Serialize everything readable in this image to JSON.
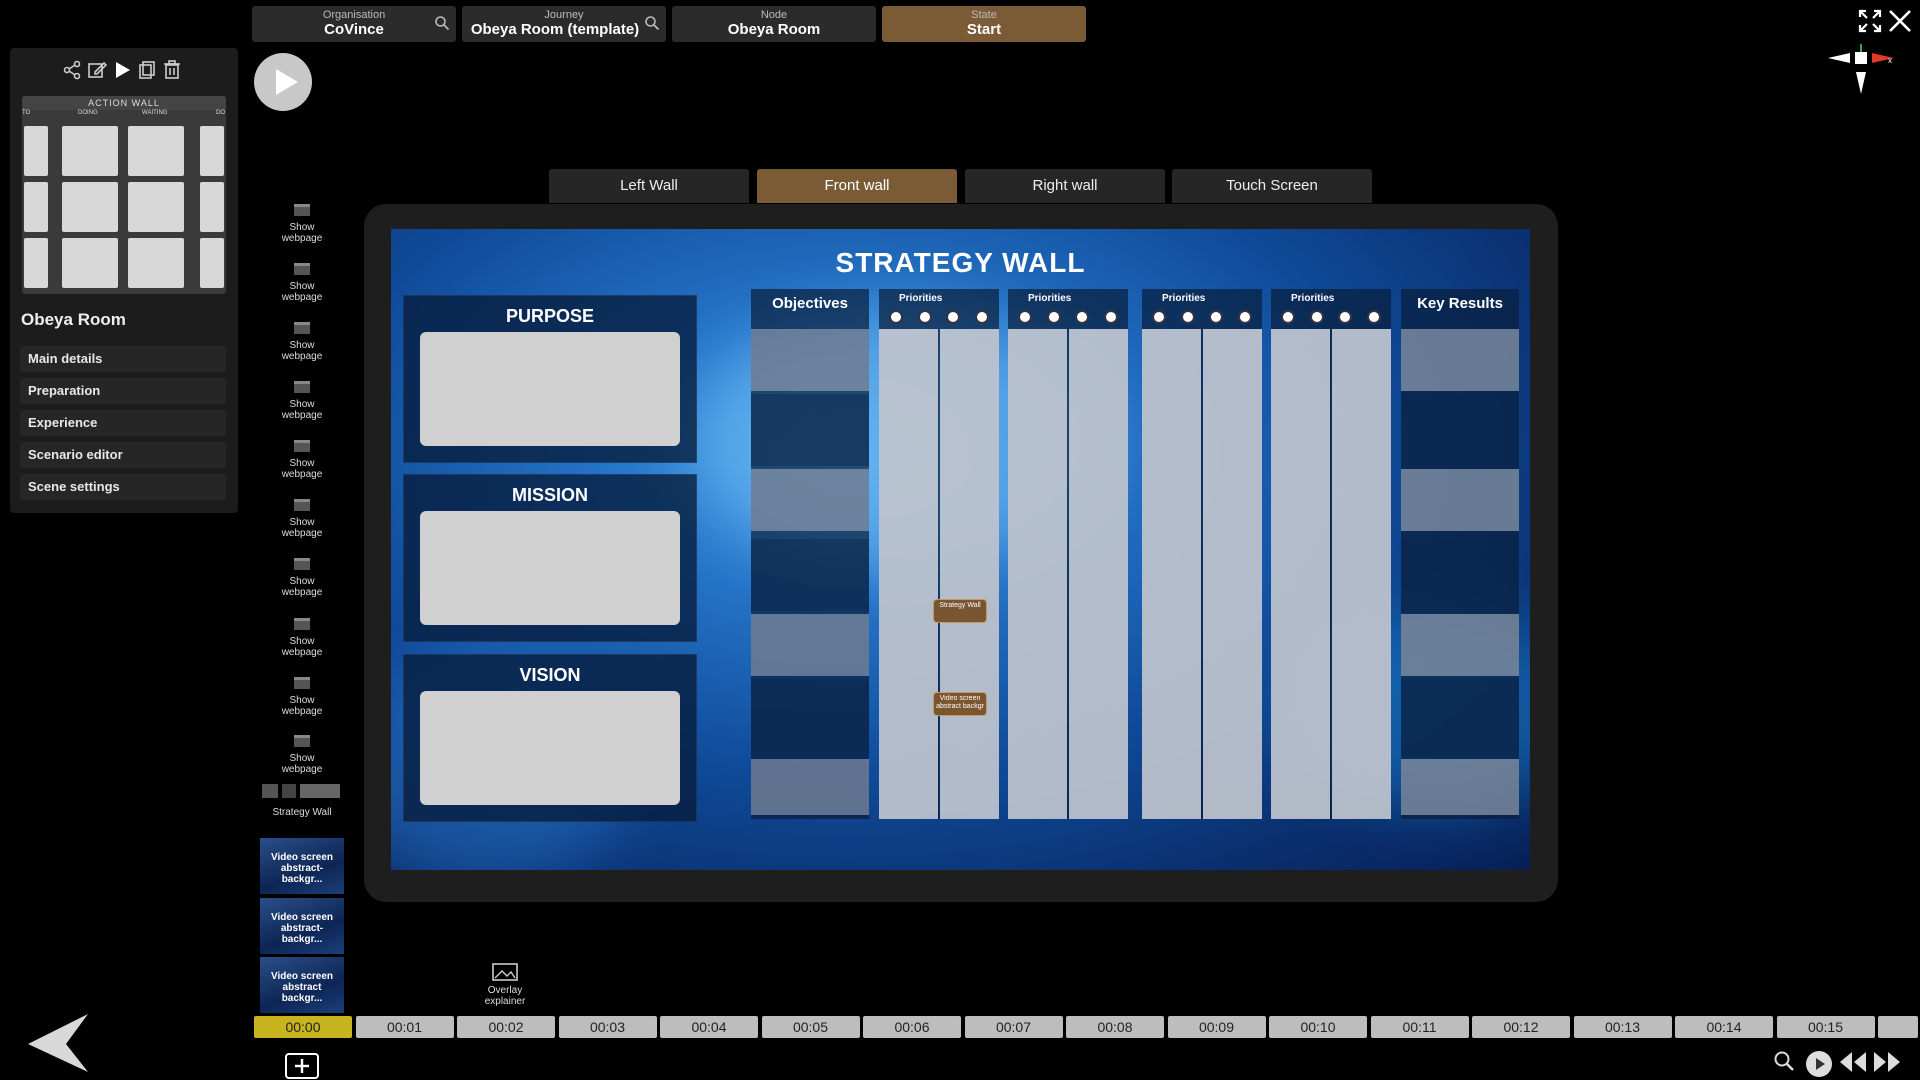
{
  "breadcrumb": [
    {
      "label": "Organisation",
      "value": "CoVince",
      "search": true
    },
    {
      "label": "Journey",
      "value": "Obeya Room (template)",
      "search": true
    },
    {
      "label": "Node",
      "value": "Obeya Room",
      "search": false
    },
    {
      "label": "State",
      "value": "Start",
      "search": false,
      "active": true
    }
  ],
  "sidebar": {
    "preview_title": "ACTION WALL",
    "preview_columns": [
      "TO",
      "DOING",
      "WAITING",
      "DO"
    ],
    "room_name": "Obeya Room",
    "menu": [
      "Main details",
      "Preparation",
      "Experience",
      "Scenario editor",
      "Scene settings"
    ]
  },
  "scene_items": {
    "webpage_label": "Show webpage",
    "webpage_count": 10,
    "strategy_label": "Strategy Wall",
    "videos": [
      "Video screen abstract-backgr...",
      "Video screen abstract-backgr...",
      "Video screen abstract backgr..."
    ]
  },
  "tabs": [
    {
      "label": "Left Wall",
      "active": false
    },
    {
      "label": "Front wall",
      "active": true
    },
    {
      "label": "Right wall",
      "active": false
    },
    {
      "label": "Touch Screen",
      "active": false
    }
  ],
  "wall": {
    "title": "STRATEGY WALL",
    "sections": [
      "PURPOSE",
      "MISSION",
      "VISION"
    ],
    "objectives": "Objectives",
    "priorities": "Priorities",
    "key_results": "Key Results",
    "tag1": "Strategy Wall",
    "tag2": "Video screen abstract backgr"
  },
  "overlay_label": "Overlay explainer",
  "timeline": [
    "00:00",
    "00:01",
    "00:02",
    "00:03",
    "00:04",
    "00:05",
    "00:06",
    "00:07",
    "00:08",
    "00:09",
    "00:10",
    "00:11",
    "00:12",
    "00:13",
    "00:14",
    "00:15"
  ],
  "colors": {
    "accent": "#7a5b36",
    "timeline_active": "#c7b41e"
  }
}
